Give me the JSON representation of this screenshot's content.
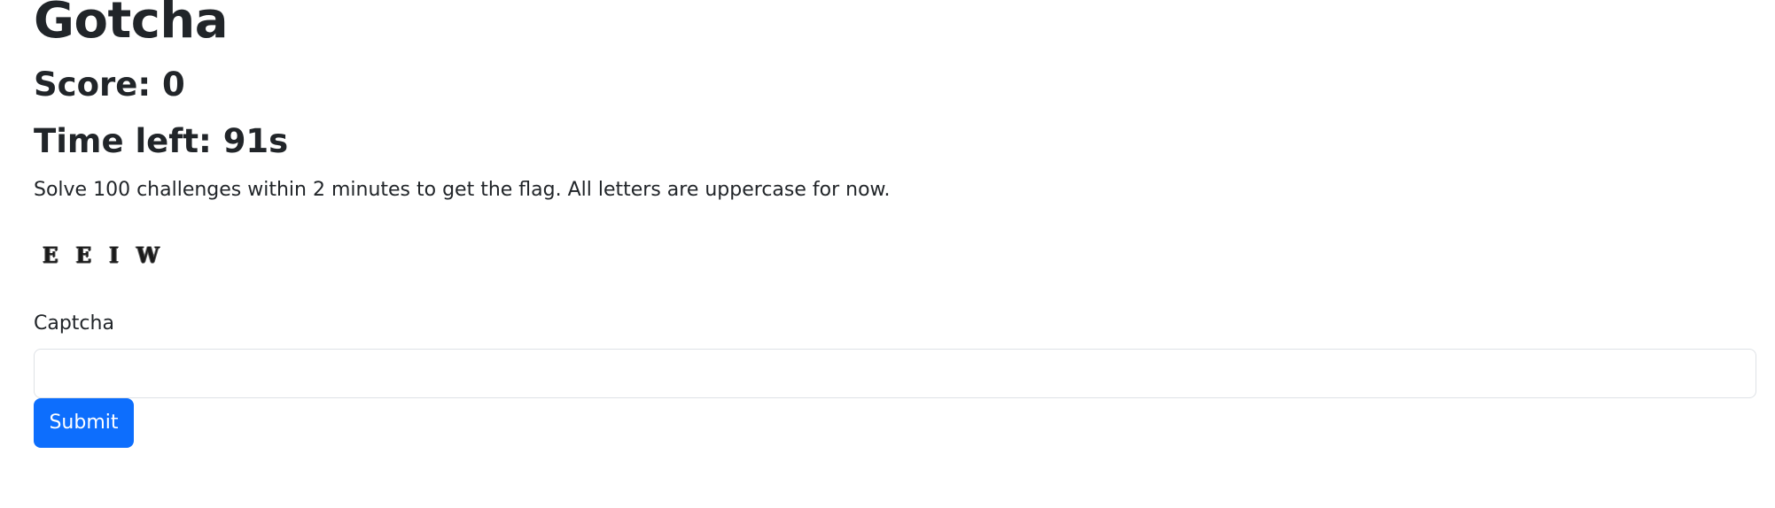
{
  "page": {
    "title": "Gotcha",
    "score_text": "Score: 0",
    "time_left_text": "Time left: 91s",
    "instructions": "Solve 100 challenges within 2 minutes to get the flag. All letters are uppercase for now."
  },
  "captcha": {
    "characters": [
      "E",
      "E",
      "I",
      "W"
    ],
    "label": "Captcha",
    "input_value": "",
    "input_placeholder": ""
  },
  "form": {
    "submit_label": "Submit"
  },
  "colors": {
    "primary": "#0d6efd",
    "text": "#212529",
    "border": "#dee2e6",
    "background": "#ffffff"
  }
}
